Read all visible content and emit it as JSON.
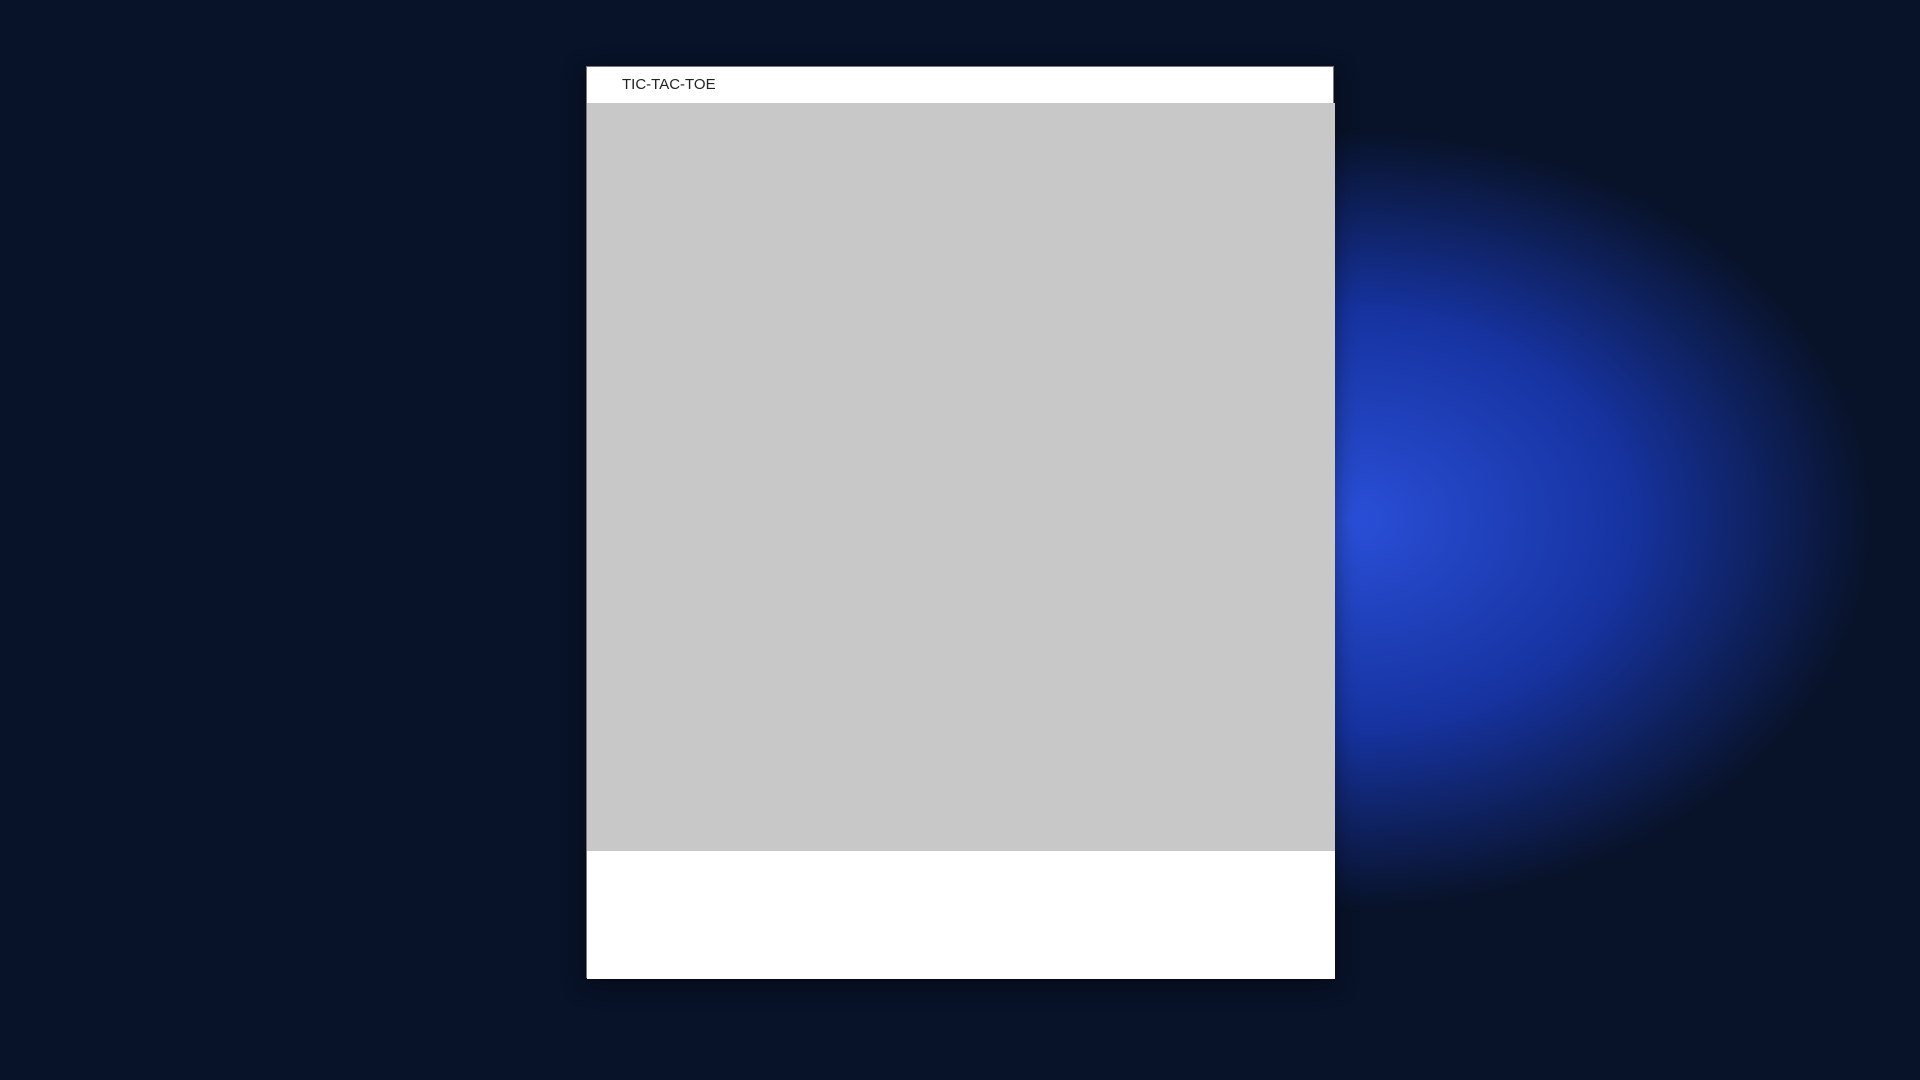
{
  "window": {
    "title": "TIC-TAC-TOE"
  }
}
